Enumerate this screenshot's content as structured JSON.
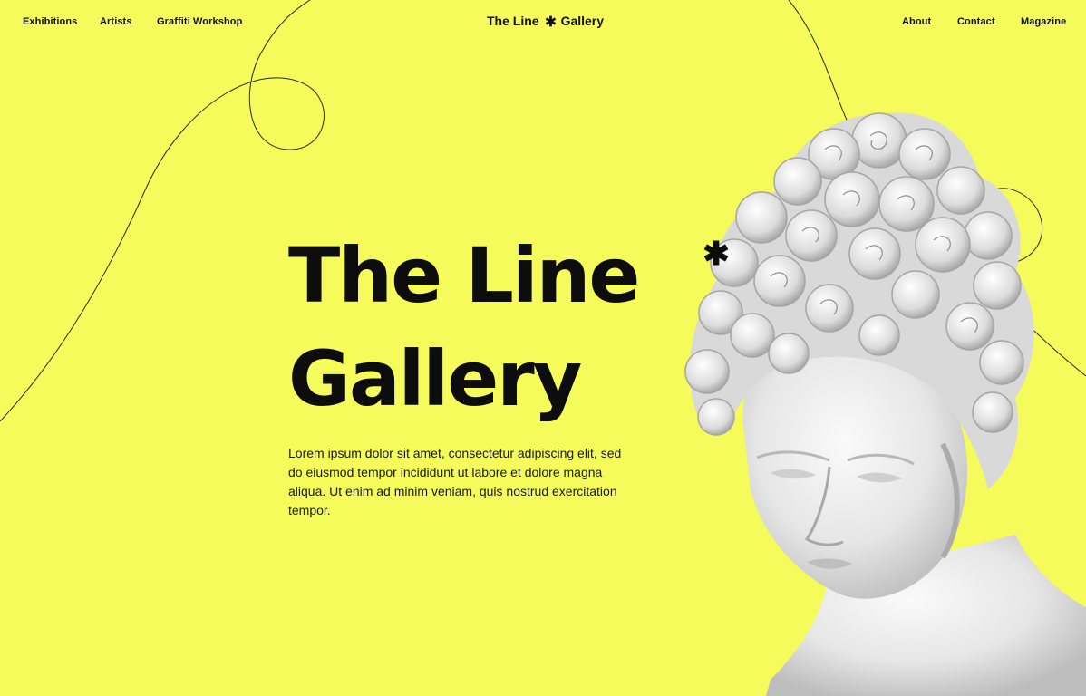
{
  "nav": {
    "left": [
      {
        "label": "Exhibitions"
      },
      {
        "label": "Artists"
      },
      {
        "label": "Graffiti Workshop"
      }
    ],
    "brand": {
      "before": "The Line",
      "after": "Gallery"
    },
    "right": [
      {
        "label": "About"
      },
      {
        "label": "Contact"
      },
      {
        "label": "Magazine"
      }
    ]
  },
  "hero": {
    "title_line1": "The Line",
    "title_line2": "Gallery",
    "description": "Lorem ipsum dolor sit amet, consectetur adipiscing elit, sed do eiusmod tempor incididunt ut labore et dolore magna aliqua. Ut enim ad minim veniam, quis nostrud exercitation tempor."
  },
  "icons": {
    "brand_mark": "asterisk-icon",
    "title_mark": "asterisk-icon",
    "statue": "marble-bust-image"
  },
  "colors": {
    "background": "#F5FB5A",
    "text": "#111111",
    "statue": "#EDEDED"
  }
}
